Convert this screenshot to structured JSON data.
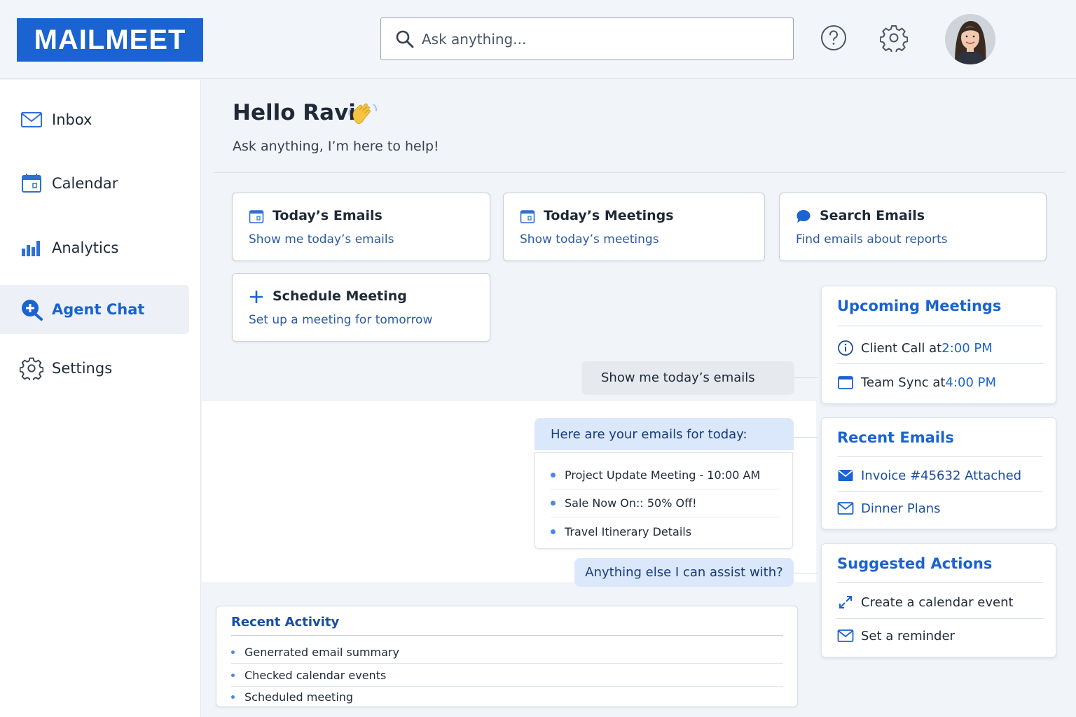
{
  "header": {
    "logo": "MAILMEET",
    "search_placeholder": "Ask anything..."
  },
  "sidebar": {
    "items": [
      {
        "label": "Inbox",
        "icon": "mail-icon"
      },
      {
        "label": "Calendar",
        "icon": "calendar-icon"
      },
      {
        "label": "Analytics",
        "icon": "bar-chart-icon"
      },
      {
        "label": "Agent Chat",
        "icon": "chat-plus-icon",
        "active": true
      },
      {
        "label": "Settings",
        "icon": "gear-icon"
      }
    ]
  },
  "main": {
    "greeting": "Hello Ravi",
    "subgreeting": "Ask anything, I’m here to help!",
    "quick_actions": [
      {
        "title": "Today’s Emails",
        "subtitle": "Show me today’s emails",
        "icon": "calendar-icon"
      },
      {
        "title": "Today’s Meetings",
        "subtitle": "Show today’s meetings",
        "icon": "calendar-icon"
      },
      {
        "title": "Search Emails",
        "subtitle": "Find emails about reports",
        "icon": "chat-bubble-icon"
      },
      {
        "title": "Schedule Meeting",
        "subtitle": "Set up a meeting for tomorrow",
        "icon": "plus-icon"
      }
    ]
  },
  "chat": {
    "user_message": "Show me today’s emails",
    "bot_intro": "Here are your emails for today:",
    "emails": [
      "Project Update Meeting - 10:00 AM",
      "Sale Now On:: 50% Off!",
      "Travel Itinerary Details"
    ],
    "bot_followup": "Anything else I can assist with?"
  },
  "recent_activity": {
    "title": "Recent Activity",
    "items": [
      "Generrated email summary",
      "Checked calendar events",
      "Scheduled meeting"
    ]
  },
  "upcoming_meetings": {
    "title": "Upcoming Meetings",
    "items": [
      {
        "label": "Client Call at ",
        "time": "2:00 PM",
        "icon": "info-icon"
      },
      {
        "label": "Team Sync at ",
        "time": "4:00 PM",
        "icon": "calendar-icon"
      }
    ]
  },
  "recent_emails": {
    "title": "Recent Emails",
    "items": [
      "Invoice #45632 Attached",
      "Dinner Plans"
    ]
  },
  "suggested_actions": {
    "title": "Suggested Actions",
    "items": [
      "Create a calendar event",
      "Set a reminder"
    ]
  },
  "colors": {
    "brand": "#1a63d0",
    "bubble_user": "#e6e9ee",
    "bubble_bot": "#dbe8fb",
    "bullet": "#4a86e8"
  }
}
